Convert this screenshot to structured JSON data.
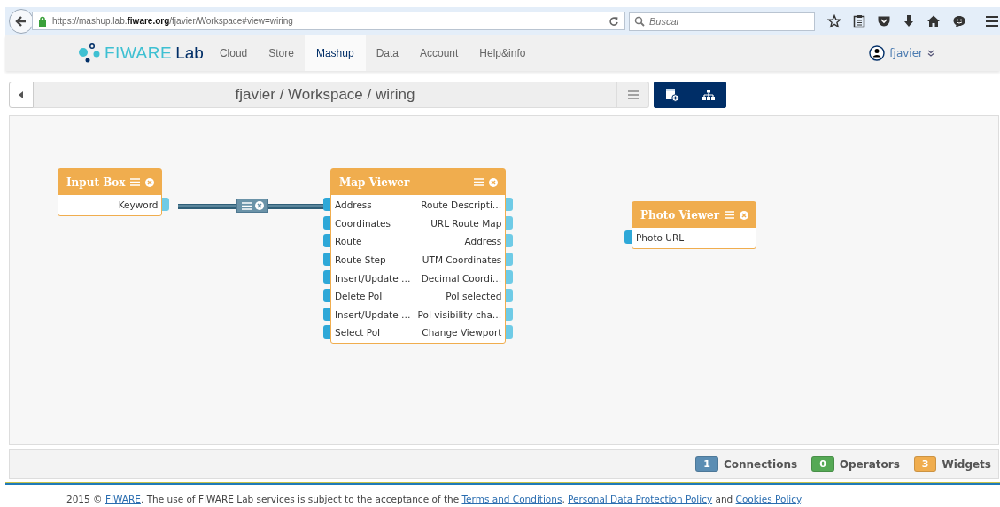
{
  "browser": {
    "url": "https://mashup.lab.**fiware.org**/fjavier/Workspace#view=wiring",
    "search": {
      "placeholder": "Buscar"
    }
  },
  "nav": {
    "logo": {
      "word": "FIWARE",
      "suffix": "Lab"
    },
    "items": [
      {
        "label": "Cloud",
        "selected": false
      },
      {
        "label": "Store",
        "selected": false
      },
      {
        "label": "Mashup",
        "selected": true
      },
      {
        "label": "Data",
        "selected": false
      },
      {
        "label": "Account",
        "selected": false
      },
      {
        "label": "Help&info",
        "selected": false
      }
    ],
    "user": "fjavier"
  },
  "toolbar": {
    "breadcrumb": "fjavier / Workspace / wiring"
  },
  "canvas": {
    "nodes": [
      {
        "title": "Input Box",
        "outputs": [
          "Keyword"
        ]
      },
      {
        "title": "Map Viewer",
        "inputs": [
          "Address",
          "Coordinates",
          "Route",
          "Route Step",
          "Insert/Update …",
          "Delete PoI",
          "Insert/Update …",
          "Select PoI"
        ],
        "outputs": [
          "Route Descripti…",
          "URL Route Map",
          "Address",
          "UTM Coordinates",
          "Decimal Coordi…",
          "PoI selected",
          "PoI visibility cha…",
          "Change Viewport"
        ]
      },
      {
        "title": "Photo Viewer",
        "inputs": [
          "Photo URL"
        ]
      }
    ]
  },
  "status_bar": [
    {
      "count": "1",
      "label": "Connections",
      "color": "#5b8db3"
    },
    {
      "count": "0",
      "label": "Operators",
      "color": "#55a955"
    },
    {
      "count": "3",
      "label": "Widgets",
      "color": "#f0ad4e"
    }
  ],
  "footer": [
    {
      "kind": "text",
      "text": "2015 © "
    },
    {
      "kind": "link",
      "text": "FIWARE"
    },
    {
      "kind": "text",
      "text": ". The use of FIWARE Lab services is subject to the acceptance of the "
    },
    {
      "kind": "link",
      "text": "Terms and Conditions"
    },
    {
      "kind": "text",
      "text": ", "
    },
    {
      "kind": "link",
      "text": "Personal Data Protection Policy"
    },
    {
      "kind": "text",
      "text": " and "
    },
    {
      "kind": "link",
      "text": "Cookies Policy"
    },
    {
      "kind": "text",
      "text": "."
    }
  ]
}
